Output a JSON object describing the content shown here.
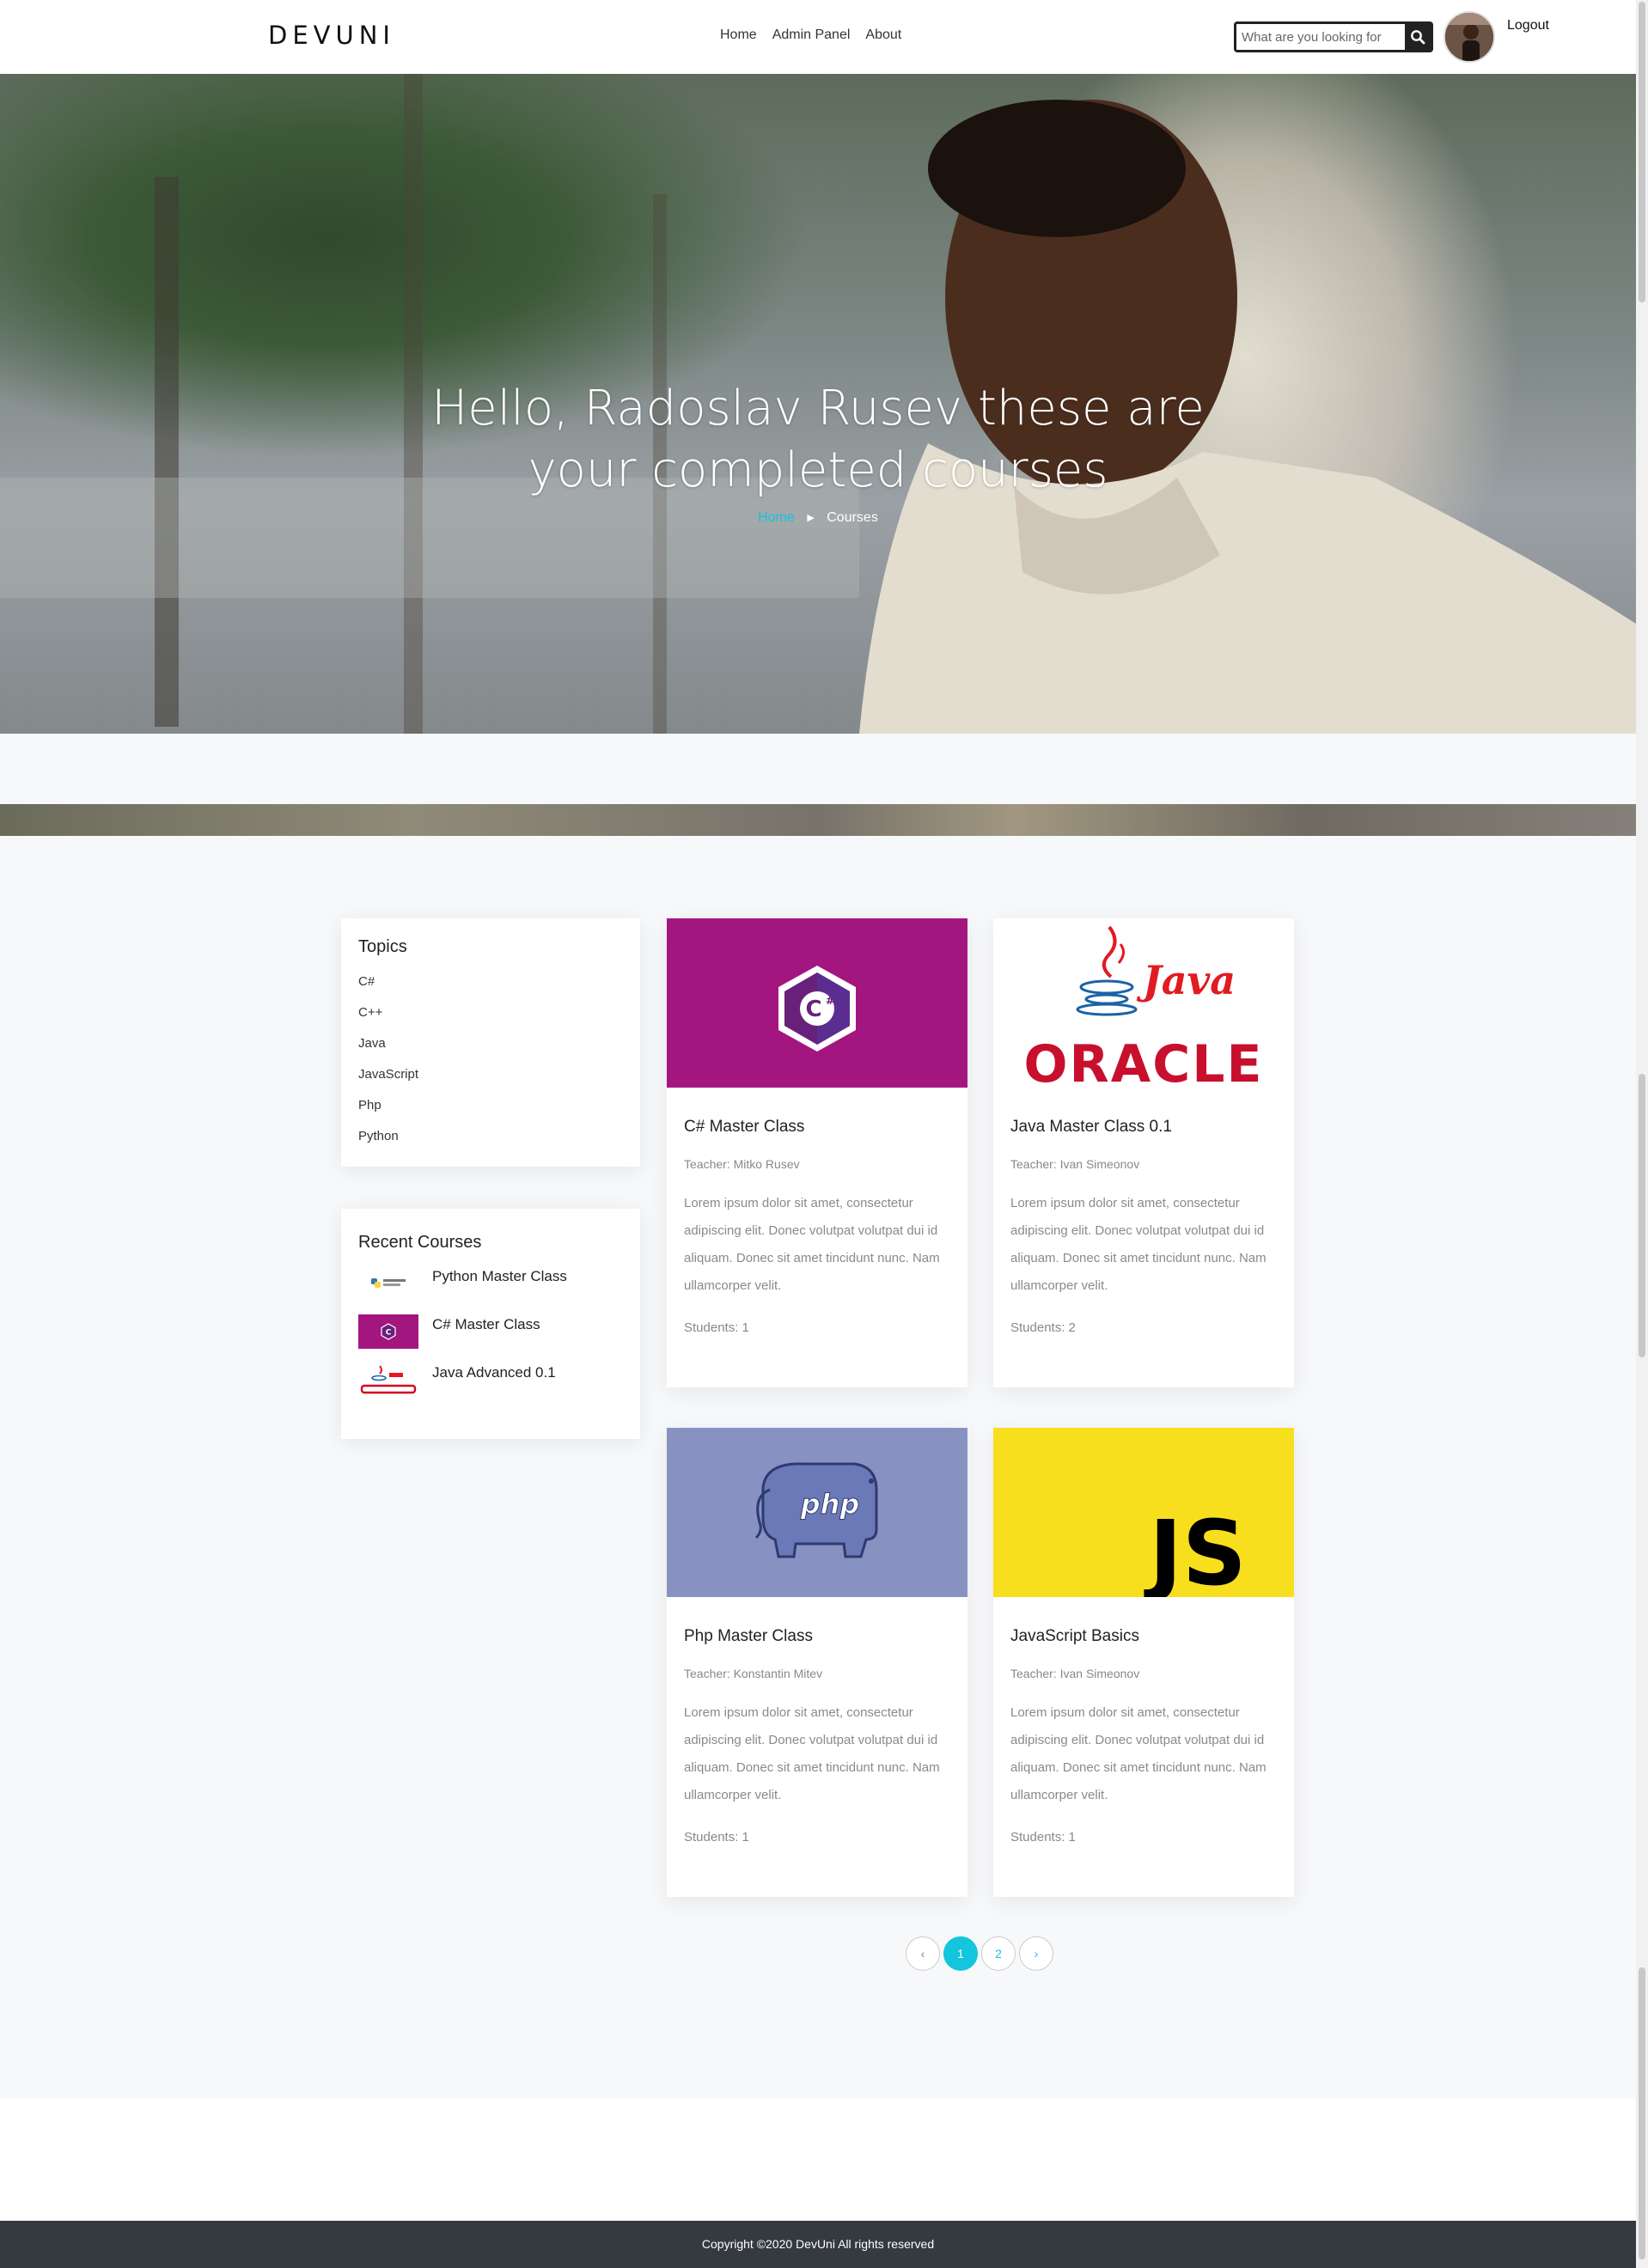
{
  "header": {
    "brand": "DEVUNI",
    "nav": [
      "Home",
      "Admin Panel",
      "About"
    ],
    "search_placeholder": "What are you looking for",
    "logout": "Logout"
  },
  "hero": {
    "title": "Hello, Radoslav Rusev these are your completed courses",
    "breadcrumb": [
      "Home",
      "Courses"
    ]
  },
  "sidebar": {
    "topics_title": "Topics",
    "topics": [
      "C#",
      "C++",
      "Java",
      "JavaScript",
      "Php",
      "Python"
    ],
    "recent_title": "Recent Courses",
    "recent": [
      {
        "title": "Python Master Class",
        "icon": "python-logo-icon"
      },
      {
        "title": "C# Master Class",
        "icon": "csharp-logo-icon"
      },
      {
        "title": "Java Advanced 0.1",
        "icon": "java-oracle-logo-icon"
      }
    ]
  },
  "courses": [
    {
      "title": "C# Master Class",
      "teacher": "Teacher: Mitko Rusev",
      "description": "Lorem ipsum dolor sit amet, consectetur adipiscing elit. Donec volutpat volutpat dui id aliquam. Donec sit amet tincidunt nunc. Nam ullamcorper velit.",
      "students": "Students: 1",
      "image": "csharp-logo",
      "image_bg": "#a4167f"
    },
    {
      "title": "Java Master Class 0.1",
      "teacher": "Teacher: Ivan Simeonov",
      "description": "Lorem ipsum dolor sit amet, consectetur adipiscing elit. Donec volutpat volutpat dui id aliquam. Donec sit amet tincidunt nunc. Nam ullamcorper velit.",
      "students": "Students: 2",
      "image": "java-oracle-logo",
      "image_bg": "#ffffff"
    },
    {
      "title": "Php Master Class",
      "teacher": "Teacher: Konstantin Mitev",
      "description": "Lorem ipsum dolor sit amet, consectetur adipiscing elit. Donec volutpat volutpat dui id aliquam. Donec sit amet tincidunt nunc. Nam ullamcorper velit.",
      "students": "Students: 1",
      "image": "php-elephant-logo",
      "image_bg": "#8892c2"
    },
    {
      "title": "JavaScript Basics",
      "teacher": "Teacher: Ivan Simeonov",
      "description": "Lorem ipsum dolor sit amet, consectetur adipiscing elit. Donec volutpat volutpat dui id aliquam. Donec sit amet tincidunt nunc. Nam ullamcorper velit.",
      "students": "Students: 1",
      "image": "js-logo",
      "image_bg": "#f7df1e"
    }
  ],
  "pagination": {
    "prev": "‹",
    "pages": [
      "1",
      "2"
    ],
    "current": "1",
    "next": "›"
  },
  "footer": {
    "copyright": "Copyright ©2020 DevUni All rights reserved"
  },
  "colors": {
    "accent": "#13c5dd",
    "footer_bg": "#343a40",
    "page_bg": "#f7f8fa"
  }
}
